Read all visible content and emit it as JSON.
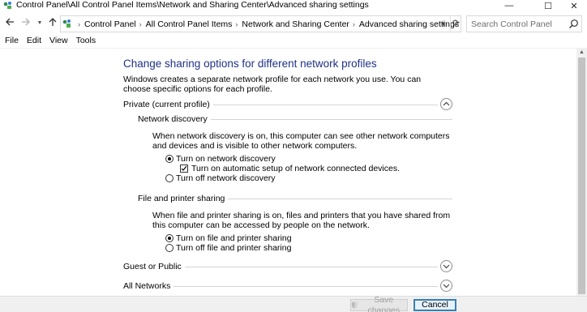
{
  "window": {
    "title": "Control Panel\\All Control Panel Items\\Network and Sharing Center\\Advanced sharing settings",
    "minimize_glyph": "—",
    "maximize_glyph": "☐",
    "close_glyph": "✕"
  },
  "nav": {
    "back_icon": "back-arrow-icon",
    "forward_icon": "forward-arrow-icon",
    "up_icon": "up-arrow-icon",
    "refresh_icon": "refresh-icon",
    "breadcrumbs": [
      "Control Panel",
      "All Control Panel Items",
      "Network and Sharing Center",
      "Advanced sharing settings"
    ],
    "search_placeholder": "Search Control Panel"
  },
  "menu": {
    "items": [
      "File",
      "Edit",
      "View",
      "Tools"
    ]
  },
  "main": {
    "heading": "Change sharing options for different network profiles",
    "intro": "Windows creates a separate network profile for each network you use. You can choose specific options for each profile.",
    "private": {
      "label": "Private (current profile)",
      "expanded": true,
      "network_discovery": {
        "label": "Network discovery",
        "description": "When network discovery is on, this computer can see other network computers and devices and is visible to other network computers.",
        "options": [
          {
            "label": "Turn on network discovery",
            "checked": true
          },
          {
            "label": "Turn on automatic setup of network connected devices.",
            "checked": true
          },
          {
            "label": "Turn off network discovery",
            "checked": false
          }
        ]
      },
      "file_printer_sharing": {
        "label": "File and printer sharing",
        "description": "When file and printer sharing is on, files and printers that you have shared from this computer can be accessed by people on the network.",
        "options": [
          {
            "label": "Turn on file and printer sharing",
            "checked": true
          },
          {
            "label": "Turn off file and printer sharing",
            "checked": false
          }
        ]
      }
    },
    "guest": {
      "label": "Guest or Public",
      "expanded": false
    },
    "all_networks": {
      "label": "All Networks",
      "expanded": false
    }
  },
  "footer": {
    "save_label": "Save changes",
    "save_enabled": false,
    "cancel_label": "Cancel"
  },
  "colors": {
    "heading": "#1e3287",
    "accent_border": "#3c7fb1"
  }
}
